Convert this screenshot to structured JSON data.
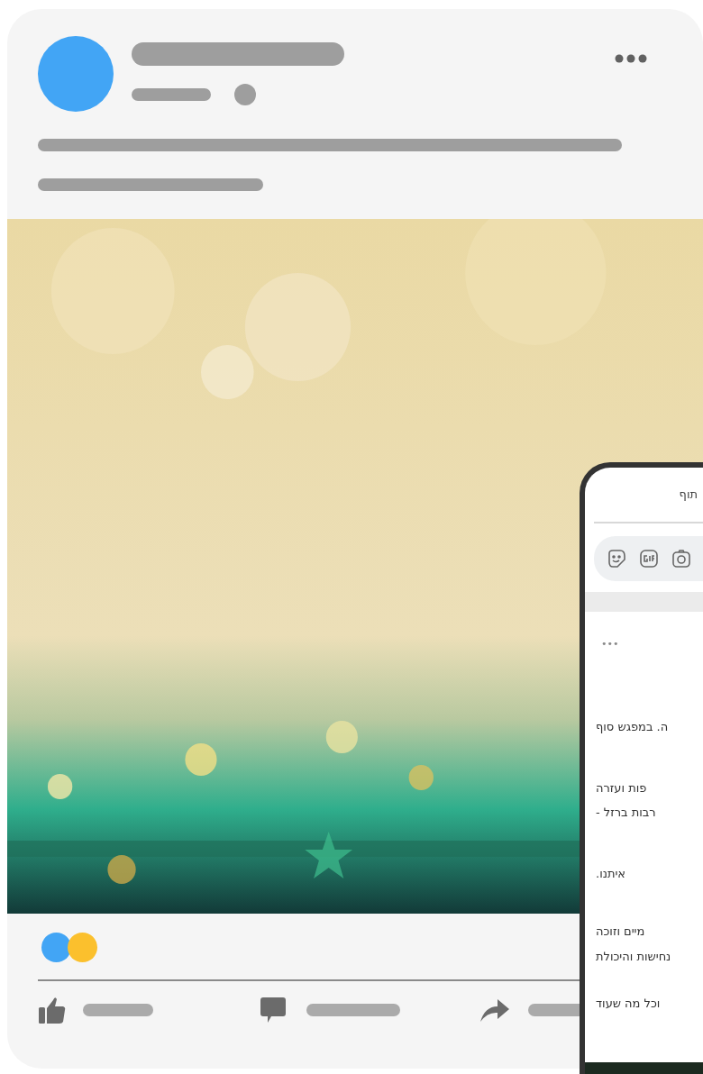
{
  "post": {
    "reactions": [
      {
        "color": "#42a5f5"
      },
      {
        "color": "#fbc02d"
      }
    ]
  },
  "phone": {
    "header": "תוף",
    "more": "•••",
    "lines": [
      "ה. במפגש סוף",
      "פות ועזרה",
      "רבות ברזל -",
      "איתנו.",
      "מיים וזוכה",
      "נחישות והיכולת",
      "וכל מה שעוד"
    ]
  }
}
